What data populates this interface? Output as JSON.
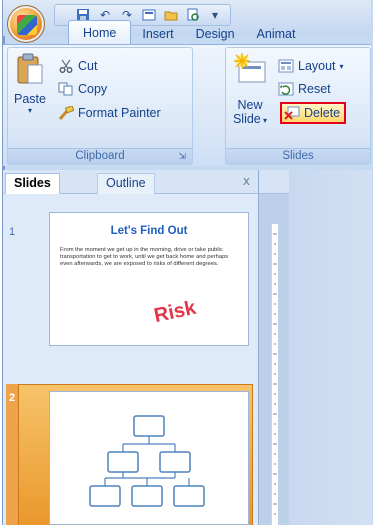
{
  "title_bar": {
    "quick_access_icons": [
      "save-icon",
      "undo-icon",
      "redo-icon",
      "layout-icon",
      "folder-icon",
      "print-preview-icon",
      "more-icon"
    ]
  },
  "tabs": [
    {
      "label": "Home",
      "active": true
    },
    {
      "label": "Insert",
      "active": false
    },
    {
      "label": "Design",
      "active": false
    },
    {
      "label": "Animat",
      "active": false
    }
  ],
  "ribbon": {
    "clipboard": {
      "label": "Clipboard",
      "paste": "Paste",
      "cut": "Cut",
      "copy": "Copy",
      "format_painter": "Format Painter"
    },
    "slides": {
      "label": "Slides",
      "new_slide_line1": "New",
      "new_slide_line2": "Slide",
      "layout": "Layout",
      "reset": "Reset",
      "delete": "Delete"
    }
  },
  "pane": {
    "tab_slides": "Slides",
    "tab_outline": "Outline",
    "close": "x",
    "slides": [
      {
        "number": "1",
        "title": "Let's Find Out",
        "body": "From the moment we get up in the morning, drive or take public transportation to get to work, until we get back home and perhaps even afterwards, we are exposed to risks of different degrees.",
        "word": "Risk"
      },
      {
        "number": "2"
      }
    ]
  },
  "colors": {
    "ribbon_bg": "#dce8f8",
    "selection": "#f0a24b",
    "highlight_box": "#e2001a",
    "risk_text": "#e0364a"
  }
}
